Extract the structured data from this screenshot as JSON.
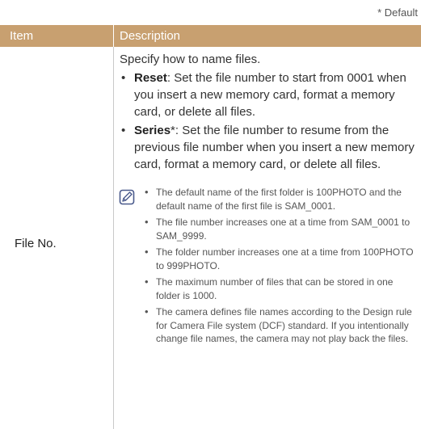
{
  "default_note": "* Default",
  "header": {
    "item_label": "Item",
    "description_label": "Description"
  },
  "row": {
    "item": "File No.",
    "intro": "Specify how to name files.",
    "options": [
      {
        "name": "Reset",
        "marker": "",
        "text": ": Set the file number to start from 0001 when you insert a new memory card, format a memory card, or delete all files."
      },
      {
        "name": "Series",
        "marker": "*",
        "text": ": Set the file number to resume from the previous file number when you insert a new memory card, format a memory card, or delete all files."
      }
    ],
    "notes": [
      "The default name of the first folder is 100PHOTO and the default name of the first file is SAM_0001.",
      "The file number increases one at a time from SAM_0001 to SAM_9999.",
      "The folder number increases one at a time from 100PHOTO to 999PHOTO.",
      "The maximum number of files that can be stored in one folder is 1000.",
      "The camera defines file names according to the Design rule for Camera File system (DCF) standard. If you intentionally change file names, the camera may not play back the files."
    ]
  },
  "colors": {
    "header_bg": "#c8a070",
    "note_icon": "#4a5a8c"
  },
  "icons": {
    "note": "note-pencil-icon"
  }
}
